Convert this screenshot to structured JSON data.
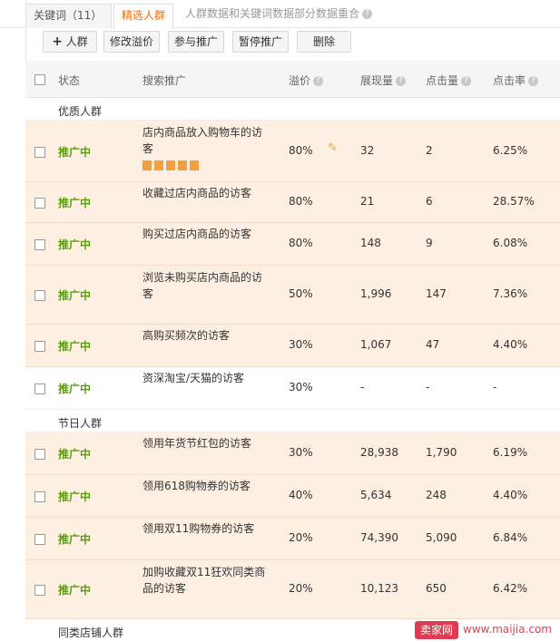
{
  "tabs": {
    "keyword": "关键词（11）",
    "selected": "精选人群",
    "description": "人群数据和关键词数据部分数据重合"
  },
  "toolbar": {
    "add_crowd": "人群",
    "modify_premium": "修改溢价",
    "join_promotion": "参与推广",
    "pause_promotion": "暂停推广",
    "delete": "删除"
  },
  "columns": {
    "status": "状态",
    "search_promotion": "搜索推广",
    "premium": "溢价",
    "impressions": "展现量",
    "clicks": "点击量",
    "ctr": "点击率"
  },
  "groups": [
    {
      "name": "优质人群",
      "rows": [
        {
          "status": "推广中",
          "name": "店内商品放入购物车的访客",
          "premium": "80%",
          "impressions": "32",
          "clicks": "2",
          "ctr": "6.25%"
        },
        {
          "status": "推广中",
          "name": "收藏过店内商品的访客",
          "premium": "80%",
          "impressions": "21",
          "clicks": "6",
          "ctr": "28.57%"
        },
        {
          "status": "推广中",
          "name": "购买过店内商品的访客",
          "premium": "80%",
          "impressions": "148",
          "clicks": "9",
          "ctr": "6.08%"
        },
        {
          "status": "推广中",
          "name": "浏览未购买店内商品的访客",
          "premium": "50%",
          "impressions": "1,996",
          "clicks": "147",
          "ctr": "7.36%"
        },
        {
          "status": "推广中",
          "name": "高购买频次的访客",
          "premium": "30%",
          "impressions": "1,067",
          "clicks": "47",
          "ctr": "4.40%"
        },
        {
          "status": "推广中",
          "name": "资深淘宝/天猫的访客",
          "premium": "30%",
          "impressions": "-",
          "clicks": "-",
          "ctr": "-"
        }
      ]
    },
    {
      "name": "节日人群",
      "rows": [
        {
          "status": "推广中",
          "name": "领用年货节红包的访客",
          "premium": "30%",
          "impressions": "28,938",
          "clicks": "1,790",
          "ctr": "6.19%"
        },
        {
          "status": "推广中",
          "name": "领用618购物券的访客",
          "premium": "40%",
          "impressions": "5,634",
          "clicks": "248",
          "ctr": "4.40%"
        },
        {
          "status": "推广中",
          "name": "领用双11购物券的访客",
          "premium": "20%",
          "impressions": "74,390",
          "clicks": "5,090",
          "ctr": "6.84%"
        },
        {
          "status": "推广中",
          "name": "加购收藏双11狂欢同类商品的访客",
          "premium": "20%",
          "impressions": "10,123",
          "clicks": "650",
          "ctr": "6.42%"
        }
      ]
    },
    {
      "name": "同类店铺人群",
      "rows": []
    }
  ],
  "watermark": {
    "badge": "卖家网",
    "url": "www.maijia.com"
  },
  "icons": {
    "add": "plus-icon",
    "help": "question-icon",
    "edit": "edit-premium-icon",
    "row_actions": [
      "pause-icon",
      "document-icon",
      "trash-icon",
      "trend-icon",
      "report-icon"
    ]
  },
  "colors": {
    "active_tab": "#ff6a00",
    "status_active": "#5a9e0e",
    "row_highlight": "#fdf0e2",
    "watermark": "#e23a50"
  }
}
